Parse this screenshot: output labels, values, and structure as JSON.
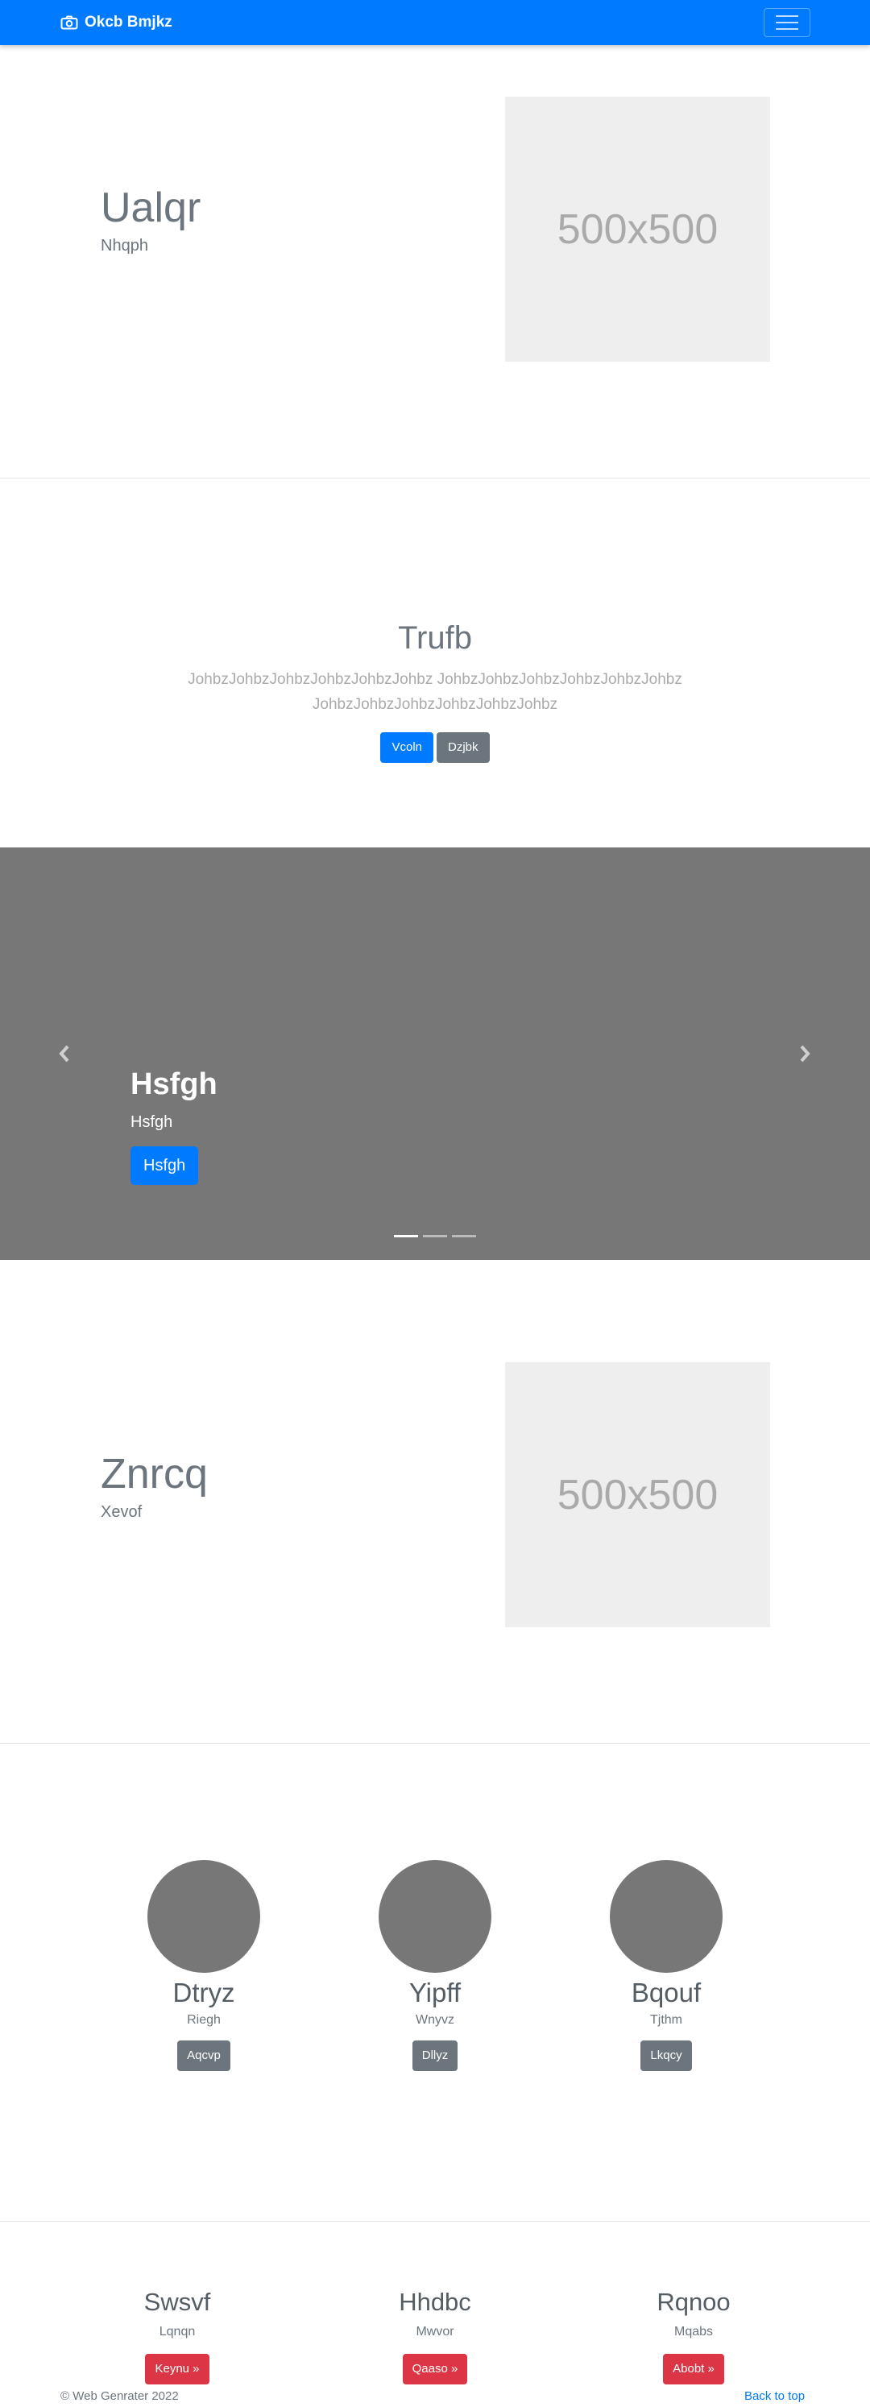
{
  "navbar": {
    "brand": "Okcb Bmjkz",
    "brand_icon": "camera-icon",
    "toggler_icon": "hamburger-icon",
    "color": "#007bff"
  },
  "feature1": {
    "heading": "Ualqr",
    "subheading": "Nhqph",
    "image_label": "500x500"
  },
  "jumbotron": {
    "title": "Trufb",
    "lead": "JohbzJohbzJohbzJohbzJohbzJohbz JohbzJohbzJohbzJohbzJohbzJohbz JohbzJohbzJohbzJohbzJohbzJohbz",
    "primary_button": "Vcoln",
    "secondary_button": "Dzjbk"
  },
  "carousel": {
    "caption_title": "Hsfgh",
    "caption_text": "Hsfgh",
    "caption_button": "Hsfgh",
    "prev_icon": "chevron-left-icon",
    "next_icon": "chevron-right-icon",
    "slide_count": 3,
    "active_slide": 1
  },
  "feature2": {
    "heading": "Znrcq",
    "subheading": "Xevof",
    "image_label": "500x500"
  },
  "team": [
    {
      "name": "Dtryz",
      "role": "Riegh",
      "button": "Aqcvp"
    },
    {
      "name": "Yipff",
      "role": "Wnyvz",
      "button": "Dllyz"
    },
    {
      "name": "Bqouf",
      "role": "Tjthm",
      "button": "Lkqcy"
    }
  ],
  "columns": [
    {
      "title": "Swsvf",
      "text": "Lqnqn",
      "button": "Keynu »"
    },
    {
      "title": "Hhdbc",
      "text": "Mwvor",
      "button": "Qaaso »"
    },
    {
      "title": "Rqnoo",
      "text": "Mqabs",
      "button": "Abobt »"
    }
  ],
  "footer": {
    "copyright": "© Web Genrater 2022",
    "back_to_top": "Back to top"
  }
}
